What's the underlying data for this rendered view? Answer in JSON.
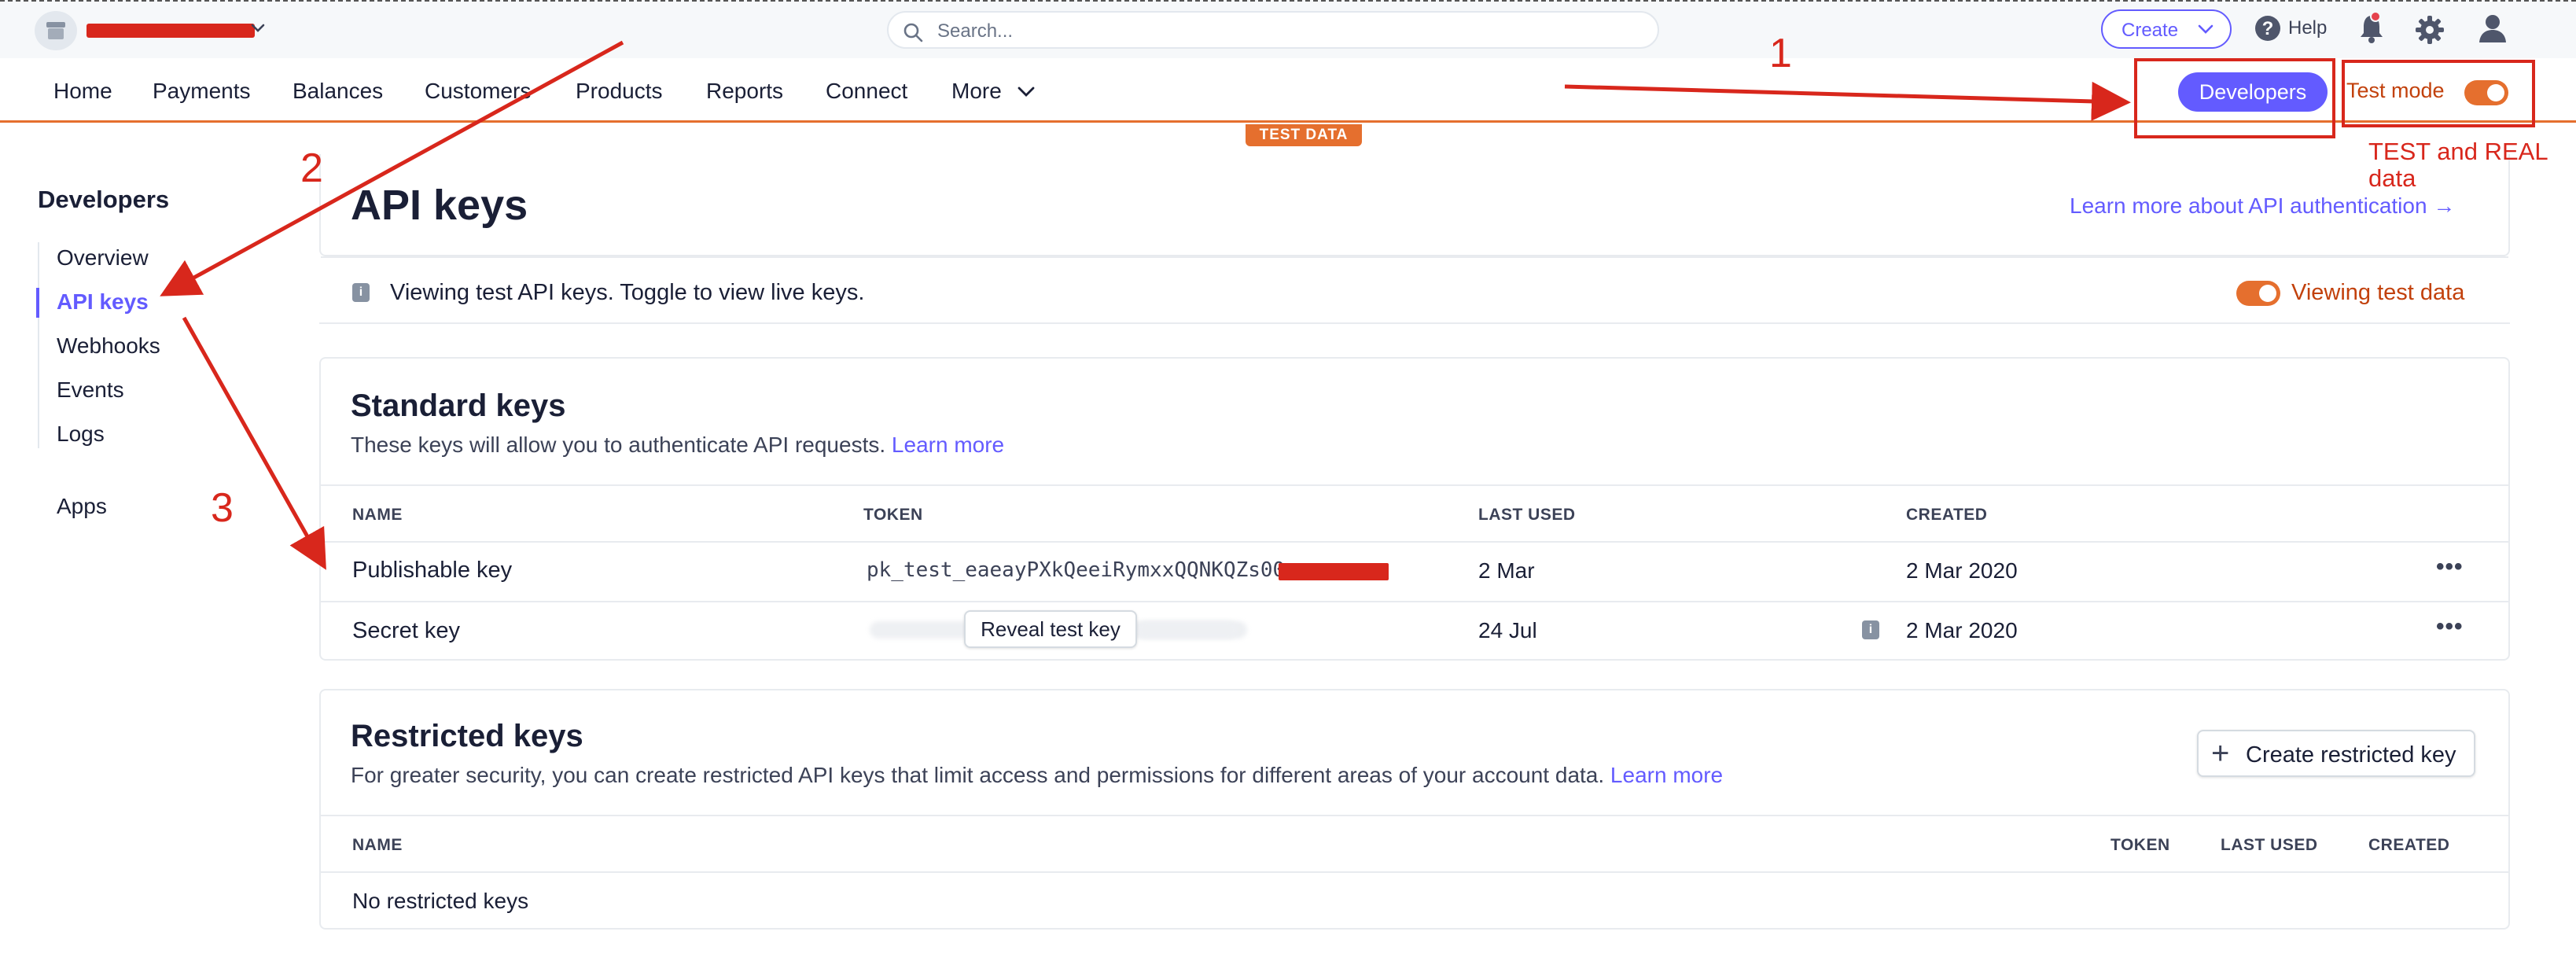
{
  "topbar": {
    "search_placeholder": "Search...",
    "create_label": "Create",
    "help_label": "Help"
  },
  "nav": {
    "items": [
      "Home",
      "Payments",
      "Balances",
      "Customers",
      "Products",
      "Reports",
      "Connect",
      "More"
    ],
    "developers_label": "Developers",
    "test_mode_label": "Test mode",
    "test_data_tag": "TEST DATA"
  },
  "sidebar": {
    "title": "Developers",
    "items": [
      "Overview",
      "API keys",
      "Webhooks",
      "Events",
      "Logs",
      "Apps"
    ],
    "active": "API keys"
  },
  "page": {
    "title": "API keys",
    "learn_more_auth": "Learn more about API authentication →",
    "banner_text": "Viewing test API keys. Toggle to view live keys.",
    "viewing_label": "Viewing test data"
  },
  "standard_keys": {
    "title": "Standard keys",
    "desc": "These keys will allow you to authenticate API requests.",
    "learn_more": "Learn more",
    "columns": [
      "NAME",
      "TOKEN",
      "LAST USED",
      "CREATED"
    ],
    "rows": [
      {
        "name": "Publishable key",
        "token": "pk_test_eaeayPXkQeeiRymxxQQNKQZs00",
        "last_used": "2 Mar",
        "created": "2 Mar 2020"
      },
      {
        "name": "Secret key",
        "token": "",
        "last_used": "24 Jul",
        "created": "2 Mar 2020"
      }
    ],
    "reveal_label": "Reveal test key",
    "more_glyph": "•••"
  },
  "restricted_keys": {
    "title": "Restricted keys",
    "desc": "For greater security, you can create restricted API keys that limit access and permissions for different areas of your account data.",
    "learn_more": "Learn more",
    "create_label": "Create restricted key",
    "columns": [
      "NAME",
      "TOKEN",
      "LAST USED",
      "CREATED"
    ],
    "empty_text": "No restricted keys"
  },
  "annotations": {
    "n1": "1",
    "n2": "2",
    "n3": "3",
    "note": "TEST and REAL data"
  },
  "colors": {
    "accent": "#635bff",
    "test_orange": "#e56f2e",
    "annotation_red": "#d8271c"
  }
}
